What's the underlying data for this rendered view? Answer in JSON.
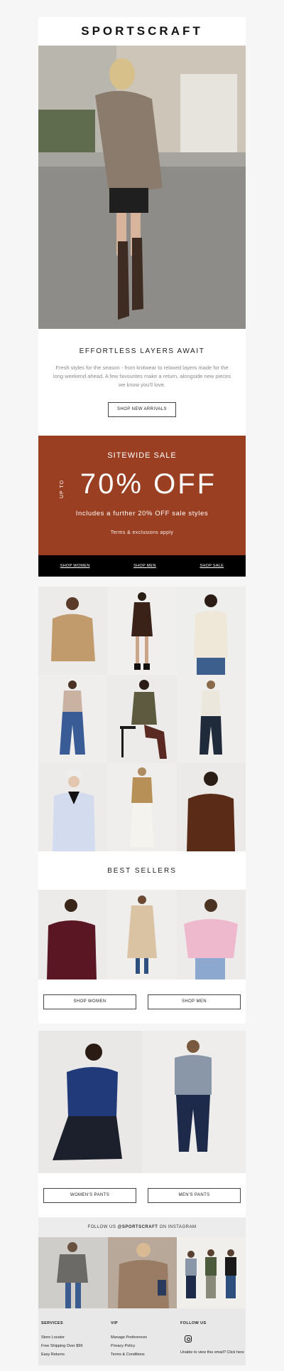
{
  "brand": {
    "name": "SPORTSCRAFT"
  },
  "intro": {
    "title": "EFFORTLESS LAYERS AWAIT",
    "body": "Fresh styles for the season - from knitwear to relaxed layers made for the long weekend ahead. A few favourites make a return, alongside new pieces we know you'll love.",
    "cta": "SHOP NEW ARRIVALS"
  },
  "sale": {
    "title": "SITEWIDE SALE",
    "upto": "UP TO",
    "headline": "70% OFF",
    "subline": "Includes a further 20% OFF sale styles",
    "terms": "Terms & exclusions apply",
    "links": [
      "SHOP WOMEN",
      "SHOP MEN",
      "SHOP SALE"
    ]
  },
  "best_sellers": {
    "title": "BEST SELLERS",
    "shop_women": "SHOP WOMEN",
    "shop_men": "SHOP MEN"
  },
  "pants": {
    "womens": "WOMEN'S PANTS",
    "mens": "MEN'S PANTS"
  },
  "instagram": {
    "prefix": "FOLLOW US",
    "handle": "@SPORTSCRAFT",
    "suffix": "ON INSTAGRAM"
  },
  "footer": {
    "services": {
      "heading": "SERVICES",
      "links": [
        "Store Locator",
        "Free Shipping Over $99",
        "Easy Returns"
      ]
    },
    "vip": {
      "heading": "VIP",
      "links": [
        "Manage Preferences",
        "Privacy Policy",
        "Terms & Conditions"
      ]
    },
    "follow": {
      "heading": "FOLLOW US",
      "note": "Unable to view this email? Click here"
    }
  },
  "colors": {
    "sale_bg": "#9a3f22",
    "bar_bg": "#000000",
    "page_bg": "#f6f6f6"
  }
}
